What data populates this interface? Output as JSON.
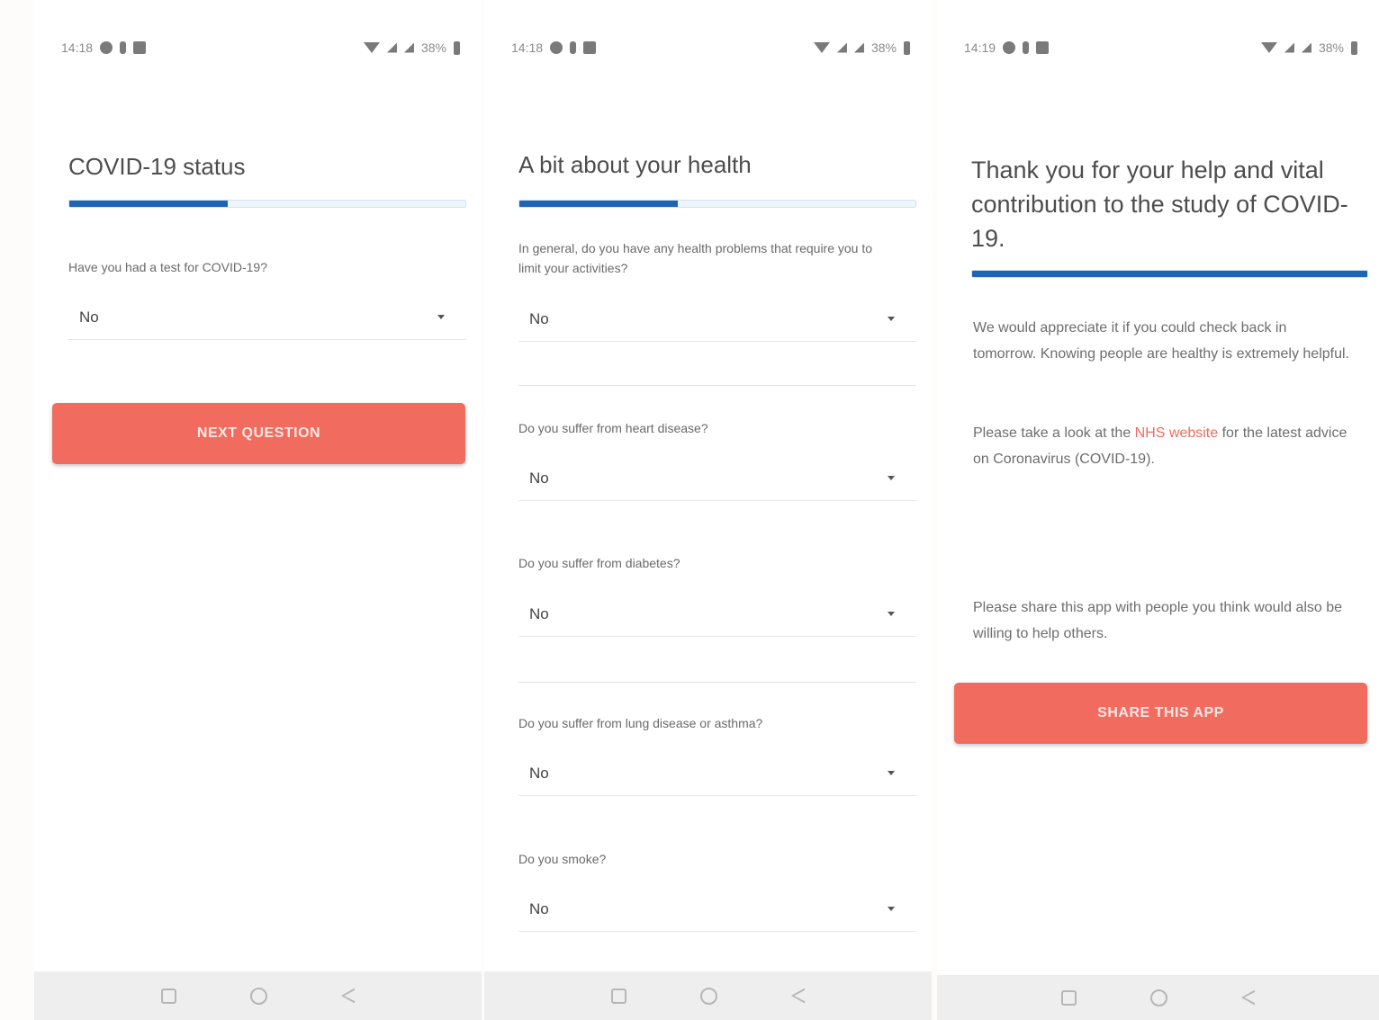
{
  "screens": [
    {
      "status_time": "14:18",
      "status_battery": "38%",
      "title": "COVID-19 status",
      "progress": 0.4,
      "questions": [
        {
          "label": "Have you had a test for COVID-19?",
          "value": "No"
        }
      ],
      "button_label": "NEXT QUESTION"
    },
    {
      "status_time": "14:18",
      "status_battery": "38%",
      "title": "A bit about your health",
      "progress": 0.4,
      "questions": [
        {
          "label": "In general, do you have any health problems that require you to limit your activities?",
          "value": "No"
        },
        {
          "label": "Do you suffer from heart disease?",
          "value": "No"
        },
        {
          "label": "Do you suffer from diabetes?",
          "value": "No"
        },
        {
          "label": "Do you suffer from lung disease or asthma?",
          "value": "No"
        },
        {
          "label": "Do you smoke?",
          "value": "No"
        }
      ]
    },
    {
      "status_time": "14:19",
      "status_battery": "38%",
      "title": "Thank you for your help and vital contribution to the study of COVID-19.",
      "progress": 1.0,
      "paragraph1": "We would appreciate it if you could check back in tomorrow. Knowing people are healthy is extremely helpful.",
      "paragraph2_pre": "Please take a look at the ",
      "paragraph2_link": "NHS website",
      "paragraph2_post": " for the latest advice on Coronavirus (COVID-19).",
      "paragraph3": "Please share this app with people you think would also be willing to help others.",
      "button_label": "SHARE THIS APP"
    }
  ],
  "colors": {
    "accent": "#f26b5f",
    "progress_fill": "#1f63b4",
    "progress_track": "#eef5fc"
  },
  "icons": {
    "status_left": [
      "sync-icon",
      "notification-icon",
      "gallery-icon"
    ],
    "status_right": [
      "wifi-icon",
      "signal-icon",
      "signal-icon",
      "battery-icon"
    ],
    "nav": [
      "recent-apps-icon",
      "home-icon",
      "back-icon"
    ]
  }
}
